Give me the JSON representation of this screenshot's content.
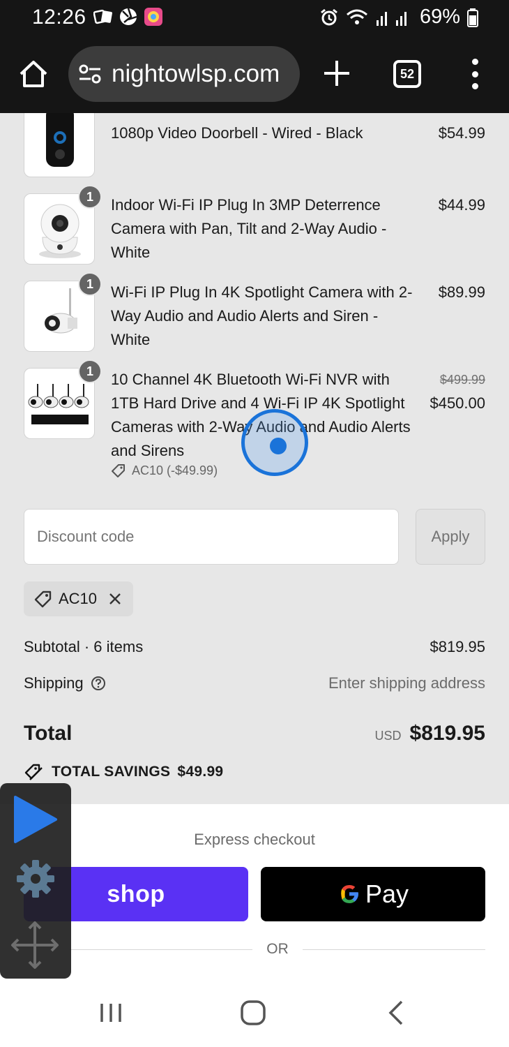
{
  "status_bar": {
    "time": "12:26",
    "battery": "69%"
  },
  "browser": {
    "url": "nightowlsp.com",
    "tab_count": "52"
  },
  "items": [
    {
      "name": "1080p Video Doorbell - Wired - Black",
      "price": "$54.99"
    },
    {
      "qty": "1",
      "name": "Indoor Wi-Fi IP Plug In 3MP Deterrence Camera with Pan, Tilt and 2-Way Audio - White",
      "price": "$44.99"
    },
    {
      "qty": "1",
      "name": "Wi-Fi IP Plug In 4K Spotlight Camera with 2-Way Audio and Audio Alerts and Siren - White",
      "price": "$89.99"
    },
    {
      "qty": "1",
      "name": "10 Channel 4K Bluetooth Wi-Fi NVR with 1TB Hard Drive and 4 Wi-Fi IP 4K Spotlight Cameras with 2-Way Audio and Audio Alerts and Sirens",
      "original_price": "$499.99",
      "price": "$450.00",
      "discount": "AC10 (-$49.99)"
    }
  ],
  "discount": {
    "placeholder": "Discount code",
    "apply_label": "Apply",
    "applied_code": "AC10"
  },
  "summary": {
    "subtotal_label": "Subtotal · 6 items",
    "subtotal_value": "$819.95",
    "shipping_label": "Shipping",
    "shipping_value": "Enter shipping address",
    "total_label": "Total",
    "currency": "USD",
    "total_value": "$819.95",
    "savings_label": "TOTAL SAVINGS",
    "savings_value": "$49.99"
  },
  "express": {
    "label": "Express checkout",
    "shop_label": "shop",
    "gpay_label": "Pay",
    "or_label": "OR"
  },
  "colors": {
    "shop_purple": "#5a31f4",
    "touch_blue": "#1a73d9",
    "tool_blue": "#2a7ae8"
  }
}
